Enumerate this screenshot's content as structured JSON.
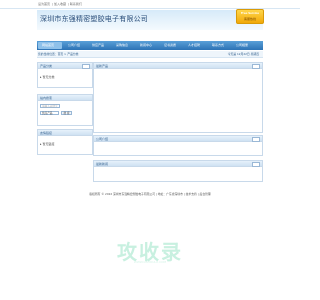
{
  "top_links": [
    "设为首页",
    "加入收藏",
    "联系我们"
  ],
  "company_name": "深圳市东强精密塑胶电子有限公司",
  "badge": {
    "line1": "Free Service",
    "line2": "客服热线"
  },
  "nav": [
    "网站首页",
    "公司介绍",
    "供应产品",
    "采购信息",
    "新闻中心",
    "证书资质",
    "人才招聘",
    "联系方式",
    "公司相册"
  ],
  "breadcrumb": {
    "left": "您的当前位置：首页 > 产品分类",
    "right": "今天是 12月22日 星期四"
  },
  "sidebar": {
    "products": {
      "title": "产品分类",
      "item": "暂无分类"
    },
    "search": {
      "title": "站内搜索",
      "input_placeholder": "请输入关键字",
      "select_value": "供应产品",
      "button": "搜 索"
    },
    "contact": {
      "title": "友情链接",
      "item": "暂无链接"
    }
  },
  "main": {
    "products_title": "最新产品",
    "company_title": "公司介绍",
    "news_title": "最新新闻"
  },
  "footer": "版权所有 © 2022 深圳市东强精密塑胶电子有限公司 | 地址：广东省深圳市 | 技术支持 | 后台管理",
  "watermark": {
    "text": "攻收录",
    "sub": "WWW.GSHOULU.COM"
  }
}
